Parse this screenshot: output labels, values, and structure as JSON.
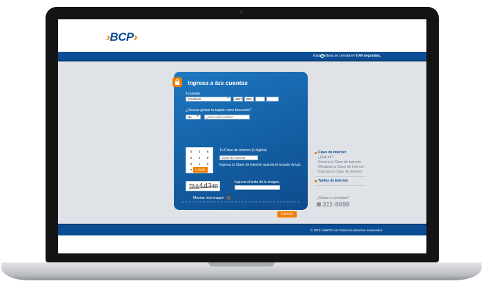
{
  "brand": {
    "logo_text": "BCP",
    "accent": "#f07d00",
    "primary": "#0b4d94"
  },
  "session": {
    "prefix": "Esta ventana se cerrará en",
    "time": "0:40 segundos."
  },
  "login": {
    "title": "Ingresa a tus cuentas",
    "card_label": "Tu tarjeta",
    "card_type": "Credimás",
    "card_number": [
      "4557",
      "883",
      "",
      ""
    ],
    "save_question": "¿Deseas grabar tu tarjeta como frecuente?",
    "save_option": "No",
    "save_name_placeholder": "¿Con cuál nombre?",
    "keypad": [
      "5",
      "3",
      "6",
      "0",
      "4",
      "8",
      "9",
      "1",
      "2",
      "7"
    ],
    "clear_label": "Limpiar",
    "password_label": "Tu Clave de Internet (6 dígitos)",
    "password_placeholder": "Clave de Internet",
    "password_hint": "Ingresa tu Clave de Internet usando el teclado virtual.",
    "captcha_text": "ma4d3m",
    "captcha_label": "Ingresa el texto de la imagen.",
    "captcha_refresh": "Mostrar otra imagen",
    "submit_label": "Ingresar"
  },
  "side_links": {
    "group1_title": "Clave de Internet",
    "group1_items": [
      "¿Qué es?",
      "Genera tu Clave de Internet",
      "Olvidaste tu Clave de Internet",
      "Cancela tu Clave de Internet"
    ],
    "group2_title": "Tarifas de Internet",
    "consult_text": "¿Dudas o consultas?",
    "phone": "311-9898"
  },
  "footer": {
    "text": "© 2013 ViaBCP.com Todos los derechos reservados"
  }
}
